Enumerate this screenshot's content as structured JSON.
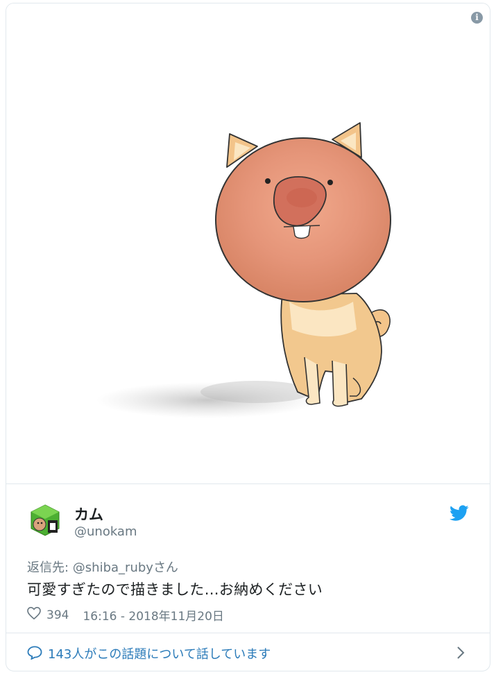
{
  "author": {
    "name": "カム",
    "handle": "@unokam"
  },
  "reply": {
    "prefix": "返信先: ",
    "mention": "@shiba_ruby",
    "suffix": "さん"
  },
  "tweet": {
    "text": "可愛すぎたので描きました…お納めください",
    "likes": "394",
    "timestamp": "16:16 - 2018年11月20日"
  },
  "footer": {
    "conversation": "143人がこの話題について話しています"
  },
  "icons": {
    "info": "info-icon",
    "twitter": "twitter-bird-icon",
    "like": "heart-icon",
    "comment": "comment-icon",
    "chevron": "chevron-right-icon"
  },
  "colors": {
    "accent": "#1da1f2",
    "link": "#2b7bb9",
    "muted": "#697882",
    "border": "#e1e8ed"
  }
}
